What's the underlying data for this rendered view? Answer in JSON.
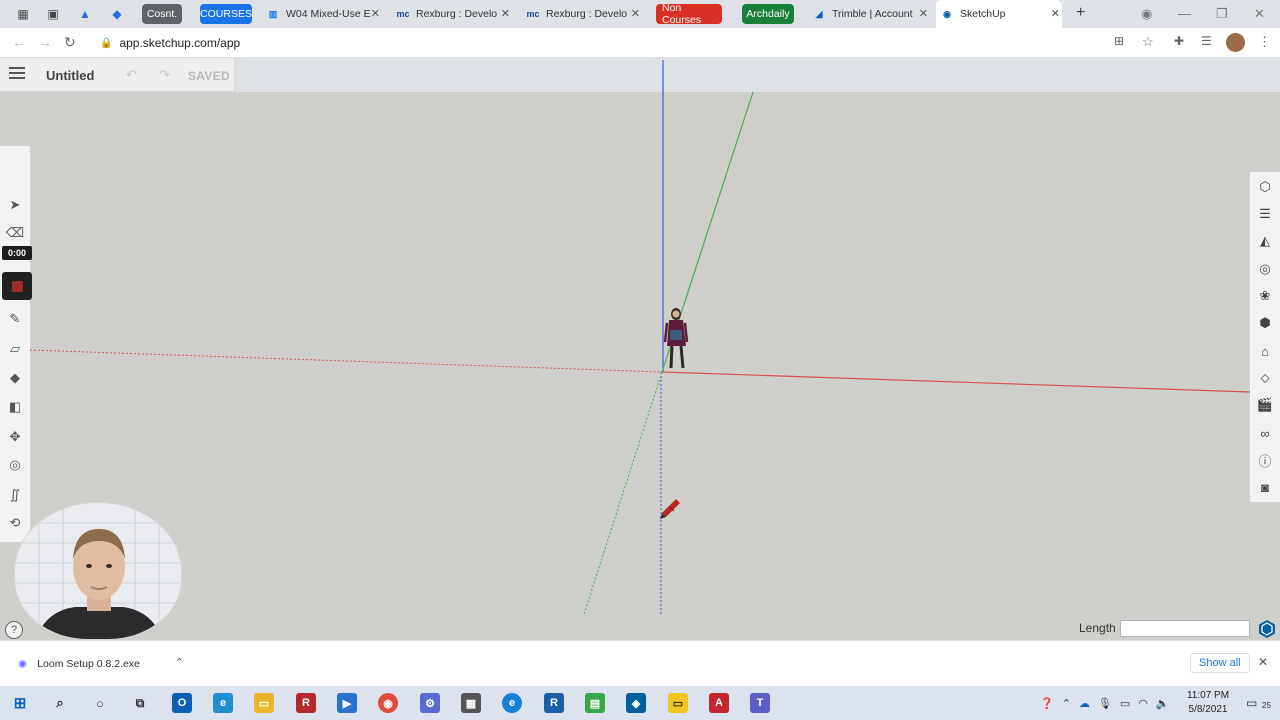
{
  "browser": {
    "tabs": [
      {
        "type": "chip",
        "label": "Cosnt.",
        "color": "#5f6368"
      },
      {
        "type": "chip",
        "label": "COURSES",
        "color": "#1a73e8"
      },
      {
        "type": "tab",
        "label": "W04 Mixed-Use E",
        "icon": "chart-icon"
      },
      {
        "type": "tab",
        "label": "Rexburg : Develo",
        "icon": "mc-icon"
      },
      {
        "type": "tab",
        "label": "Rexburg : Develo",
        "icon": "mc-icon"
      },
      {
        "type": "chip",
        "label": "Non Courses",
        "color": "#d93025"
      },
      {
        "type": "chip",
        "label": "Archdaily",
        "color": "#188038"
      },
      {
        "type": "tab",
        "label": "Trimble | Account",
        "icon": "trimble-icon"
      },
      {
        "type": "tab",
        "label": "SketchUp",
        "icon": "sketchup-icon",
        "active": true
      }
    ],
    "url": "app.sketchup.com/app"
  },
  "sketchup": {
    "doc_title": "Untitled",
    "save_status": "SAVED",
    "timer": "0:00",
    "measurement_label": "Length",
    "measurement_value": ""
  },
  "downloads": {
    "file_name": "Loom Setup 0.8.2.exe",
    "show_all": "Show all"
  },
  "taskbar": {
    "time": "11:07 PM",
    "date": "5/8/2021",
    "notification_count": "25"
  },
  "colors": {
    "x_axis": "#d9534f",
    "y_axis": "#4caf50",
    "z_axis": "#3b5bdb",
    "viewport_bg": "#cfcfcc",
    "sky_band": "#dfe2e4"
  }
}
